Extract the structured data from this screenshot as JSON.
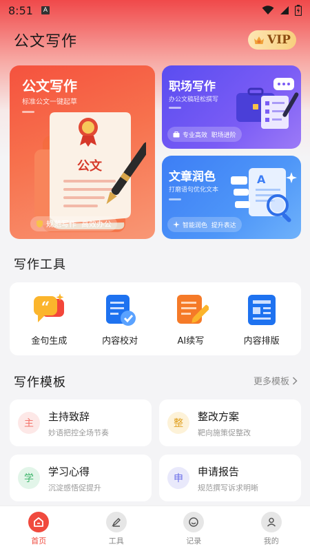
{
  "status_bar": {
    "time": "8:51",
    "notification_icon": "A"
  },
  "header": {
    "title": "公文写作",
    "vip_label": "VIP"
  },
  "cards": {
    "official": {
      "title": "公文写作",
      "subtitle": "标准公文一键起草",
      "doc_text": "公文",
      "tags": "规范写作  高效办公"
    },
    "workplace": {
      "title": "职场写作",
      "subtitle": "办公文稿轻松撰写",
      "tags": "专业高效  职场进阶"
    },
    "polish": {
      "title": "文章润色",
      "subtitle": "打磨语句优化文本",
      "tags": "智能润色  提升表达"
    }
  },
  "tools_section": {
    "title": "写作工具",
    "items": [
      {
        "label": "金句生成",
        "icon": "quote-bubble-icon"
      },
      {
        "label": "内容校对",
        "icon": "document-check-icon"
      },
      {
        "label": "AI续写",
        "icon": "document-pen-icon"
      },
      {
        "label": "内容排版",
        "icon": "document-layout-icon"
      }
    ]
  },
  "templates_section": {
    "title": "写作模板",
    "more_label": "更多模板",
    "items": [
      {
        "badge": "主",
        "title": "主持致辞",
        "subtitle": "妙语把控全场节奏",
        "color": "#f4736a",
        "bg": "#fde8e7"
      },
      {
        "badge": "整",
        "title": "整改方案",
        "subtitle": "靶向施策促整改",
        "color": "#e0a020",
        "bg": "#fdf2d8"
      },
      {
        "badge": "学",
        "title": "学习心得",
        "subtitle": "沉淀感悟促提升",
        "color": "#3fb56c",
        "bg": "#e2f5e9"
      },
      {
        "badge": "申",
        "title": "申请报告",
        "subtitle": "规范撰写诉求明晰",
        "color": "#6a6ee8",
        "bg": "#e9e9fb"
      }
    ]
  },
  "bottom_nav": {
    "items": [
      {
        "label": "首页",
        "icon": "home-icon",
        "active": true
      },
      {
        "label": "工具",
        "icon": "tools-icon",
        "active": false
      },
      {
        "label": "记录",
        "icon": "records-icon",
        "active": false
      },
      {
        "label": "我的",
        "icon": "profile-icon",
        "active": false
      }
    ]
  },
  "colors": {
    "accent": "#f04a3e",
    "purple_card": "#6a55f2",
    "blue_card": "#4a8ef7"
  }
}
